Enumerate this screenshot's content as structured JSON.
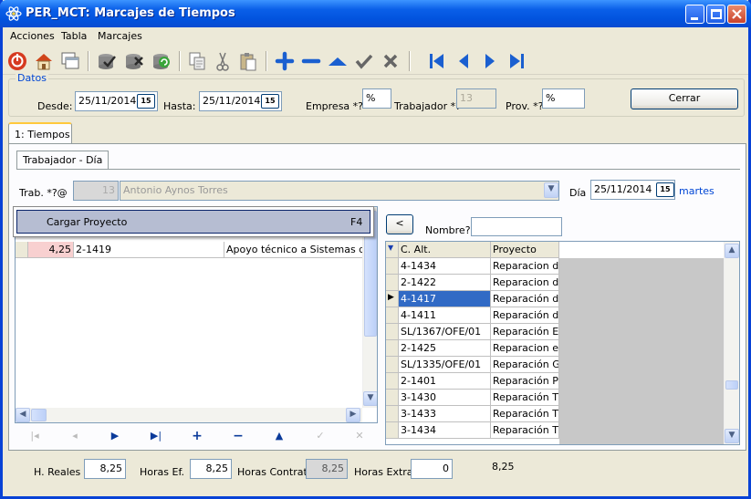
{
  "window": {
    "title": "PER_MCT: Marcajes de Tiempos"
  },
  "menu": [
    "Acciones",
    "Tabla",
    "Marcajes"
  ],
  "icons": [
    "power-icon",
    "home-icon",
    "windows-icon",
    "check-db-icon",
    "delete-db-icon",
    "refresh-db-icon",
    "copy-icon",
    "cut-icon",
    "paste-icon",
    "plus-icon",
    "minus-icon",
    "up-icon",
    "check-icon",
    "cancel-icon",
    "first-icon",
    "prev-icon",
    "next-icon",
    "last-icon"
  ],
  "datos": {
    "legend": "Datos",
    "desde_label": "Desde:",
    "desde_value": "25/11/2014",
    "hasta_label": "Hasta:",
    "hasta_value": "25/11/2014",
    "empresa_label": "Empresa *?",
    "empresa_value": "%",
    "trabajador_label": "Trabajador *?",
    "trabajador_value": "13",
    "prov_label": "Prov. *?",
    "prov_value": "%",
    "cerrar_label": "Cerrar",
    "cal_label": "15"
  },
  "tabs": {
    "main": "1: Tiempos",
    "sub": "Trabajador - Día"
  },
  "trab": {
    "label": "Trab. *?@",
    "code": "13",
    "name": "Antonio Aynos Torres",
    "dia_label": "Día",
    "dia_value": "25/11/2014",
    "weekday": "martes"
  },
  "context_menu": {
    "item": "Cargar Proyecto",
    "shortcut": "F4"
  },
  "left_grid": {
    "rows": [
      {
        "horas": "4,25",
        "codigo": "2-1419",
        "descripcion": "Apoyo técnico a Sistemas de N"
      }
    ]
  },
  "right_panel": {
    "back_label": "<",
    "nombre_label": "Nombre?",
    "nombre_value": "",
    "headers": [
      "C. Alt.",
      "Proyecto"
    ],
    "rows": [
      [
        "4-1434",
        "Reparacion de"
      ],
      [
        "2-1422",
        "Reparacion de"
      ],
      [
        "4-1417",
        "Reparación de"
      ],
      [
        "4-1411",
        "Reparación del"
      ],
      [
        "SL/1367/OFE/01",
        "Reparación En"
      ],
      [
        "2-1425",
        "Reparacion en"
      ],
      [
        "SL/1335/OFE/01",
        "Reparación GF"
      ],
      [
        "2-1401",
        "Reparación PC"
      ],
      [
        "3-1430",
        "Reparación TS"
      ],
      [
        "3-1433",
        "Reparación TS"
      ],
      [
        "3-1434",
        "Reparación TS"
      ]
    ]
  },
  "footer": {
    "h_reales_label": "H. Reales",
    "h_reales_value": "8,25",
    "horas_ef_label": "Horas Ef.",
    "horas_ef_value": "8,25",
    "horas_contrato_label": "Horas Contrato",
    "horas_contrato_value": "8,25",
    "horas_extra_label": "Horas Extra",
    "horas_extra_value": "0",
    "total_value": "8,25"
  },
  "colors": {
    "title_blue": "#0a5fe8",
    "accent_link": "#0046d5",
    "selection": "#316ac5",
    "hours_cell": "#f8d0d0"
  }
}
